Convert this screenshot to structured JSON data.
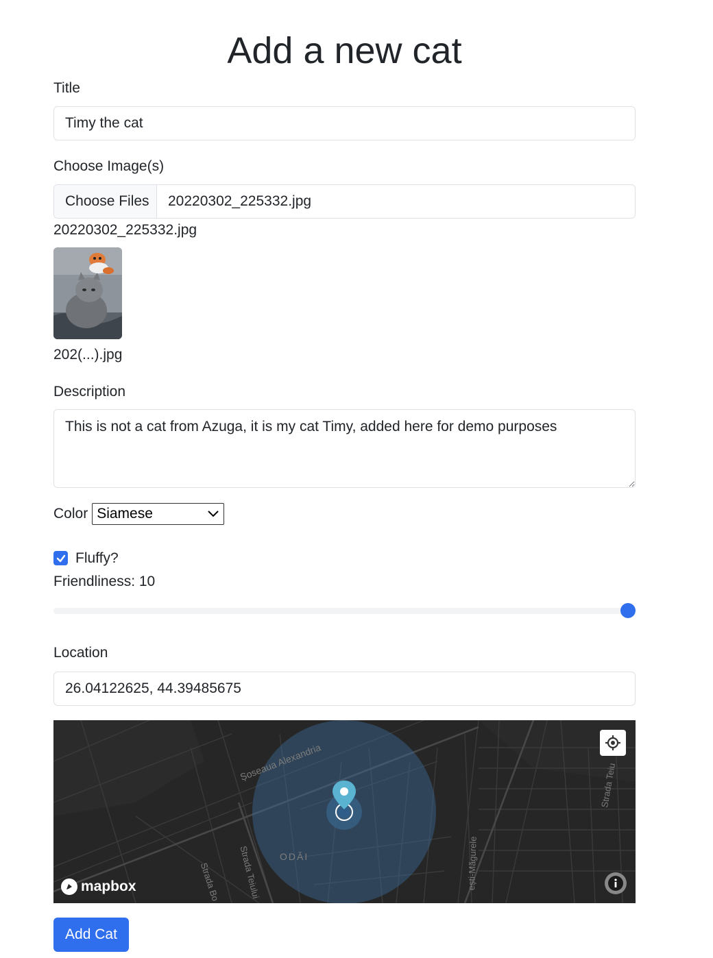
{
  "page": {
    "title": "Add a new cat"
  },
  "form": {
    "title_label": "Title",
    "title_value": "Timy the cat",
    "images_label": "Choose Image(s)",
    "file_button": "Choose Files",
    "file_chosen": "20220302_225332.jpg",
    "file_list_name": "20220302_225332.jpg",
    "thumb_caption": "202(...).jpg",
    "description_label": "Description",
    "description_value": "This is not a cat from Azuga, it is my cat Timy, added here for demo purposes",
    "color_label": "Color",
    "color_selected": "Siamese",
    "fluffy_label": "Fluffy?",
    "fluffy_checked": true,
    "friendliness_label": "Friendliness: 10",
    "friendliness_value": 10,
    "friendliness_max": 10,
    "location_label": "Location",
    "location_value": "26.04122625, 44.39485675",
    "submit_label": "Add Cat"
  },
  "map": {
    "streets": [
      "Șoseaua Alexandria",
      "Strada Teiului",
      "Strada Bo",
      "ODĂI",
      "ești-Măgurele",
      "Strada Teiu"
    ],
    "brand": "mapbox",
    "accent": "#2f6fed"
  }
}
